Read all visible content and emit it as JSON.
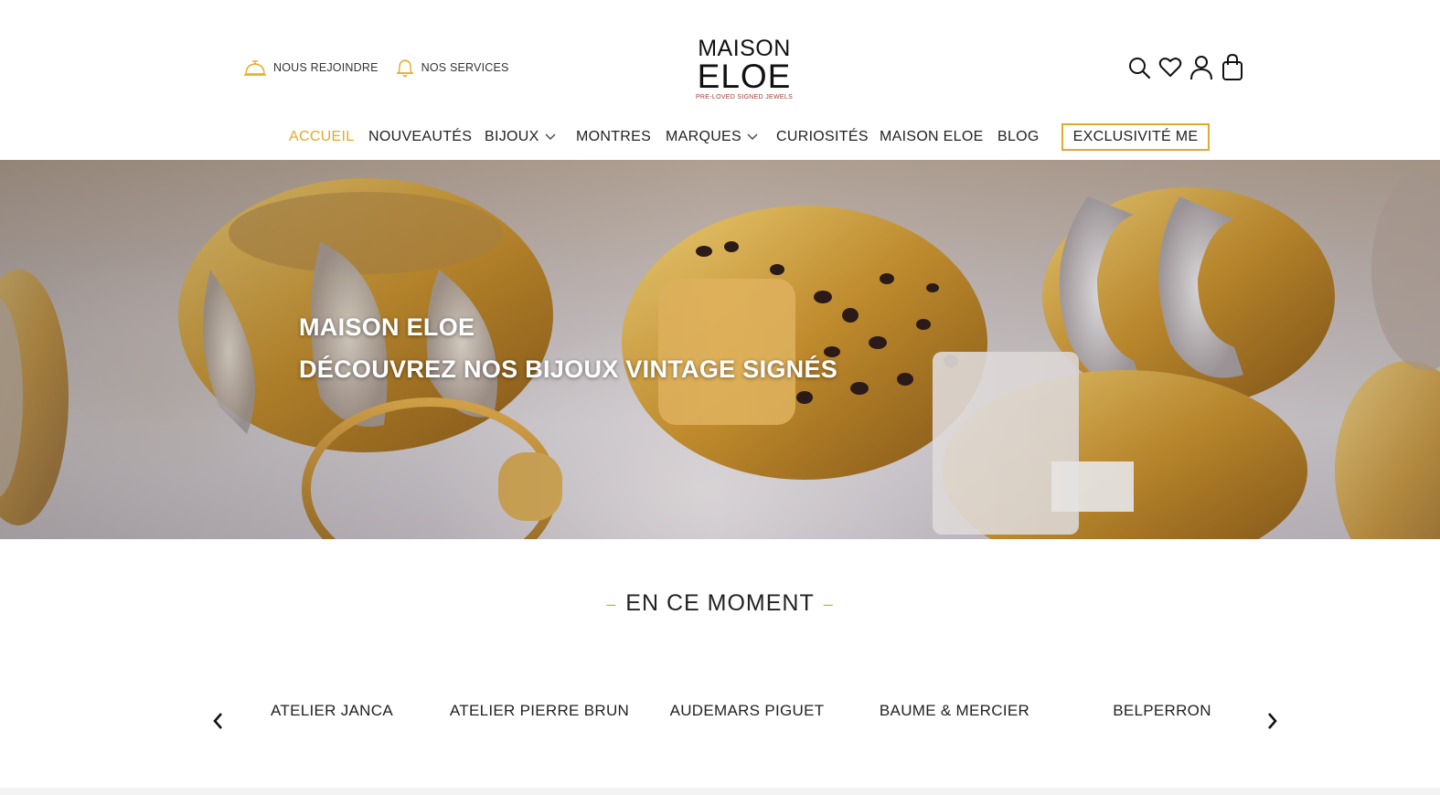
{
  "header": {
    "util_links": [
      {
        "label": "NOUS REJOINDRE",
        "icon": "service-bell-icon"
      },
      {
        "label": "NOS SERVICES",
        "icon": "bell-icon"
      }
    ],
    "logo": {
      "line1": "MAISON",
      "line2": "ELOE",
      "tagline": "PRE-LOVED SIGNED JEWELS"
    },
    "icons": [
      "search-icon",
      "heart-icon",
      "user-icon",
      "shopping-bag-icon"
    ]
  },
  "nav": {
    "items": [
      {
        "label": "ACCUEIL",
        "active": true
      },
      {
        "label": "NOUVEAUTÉS"
      },
      {
        "label": "BIJOUX",
        "dropdown": true
      },
      {
        "label": "MONTRES"
      },
      {
        "label": "MARQUES",
        "dropdown": true
      },
      {
        "label": "CURIOSITÉS"
      },
      {
        "label": "MAISON ELOE"
      },
      {
        "label": "BLOG"
      }
    ],
    "highlight": "EXCLUSIVITÉ ME"
  },
  "hero": {
    "title": "MAISON ELOE",
    "subtitle": "DÉCOUVREZ NOS BIJOUX VINTAGE SIGNÉS"
  },
  "section": {
    "title": "EN CE MOMENT",
    "dash": "–"
  },
  "carousel": {
    "brands": [
      "ATELIER JANCA",
      "ATELIER PIERRE BRUN",
      "AUDEMARS PIGUET",
      "BAUME & MERCIER",
      "BELPERRON"
    ],
    "prev_icon": "chevron-left-icon",
    "next_icon": "chevron-right-icon"
  },
  "colors": {
    "accent": "#e3a92b",
    "text": "#222222",
    "logo_tagline": "#a33a3a"
  }
}
